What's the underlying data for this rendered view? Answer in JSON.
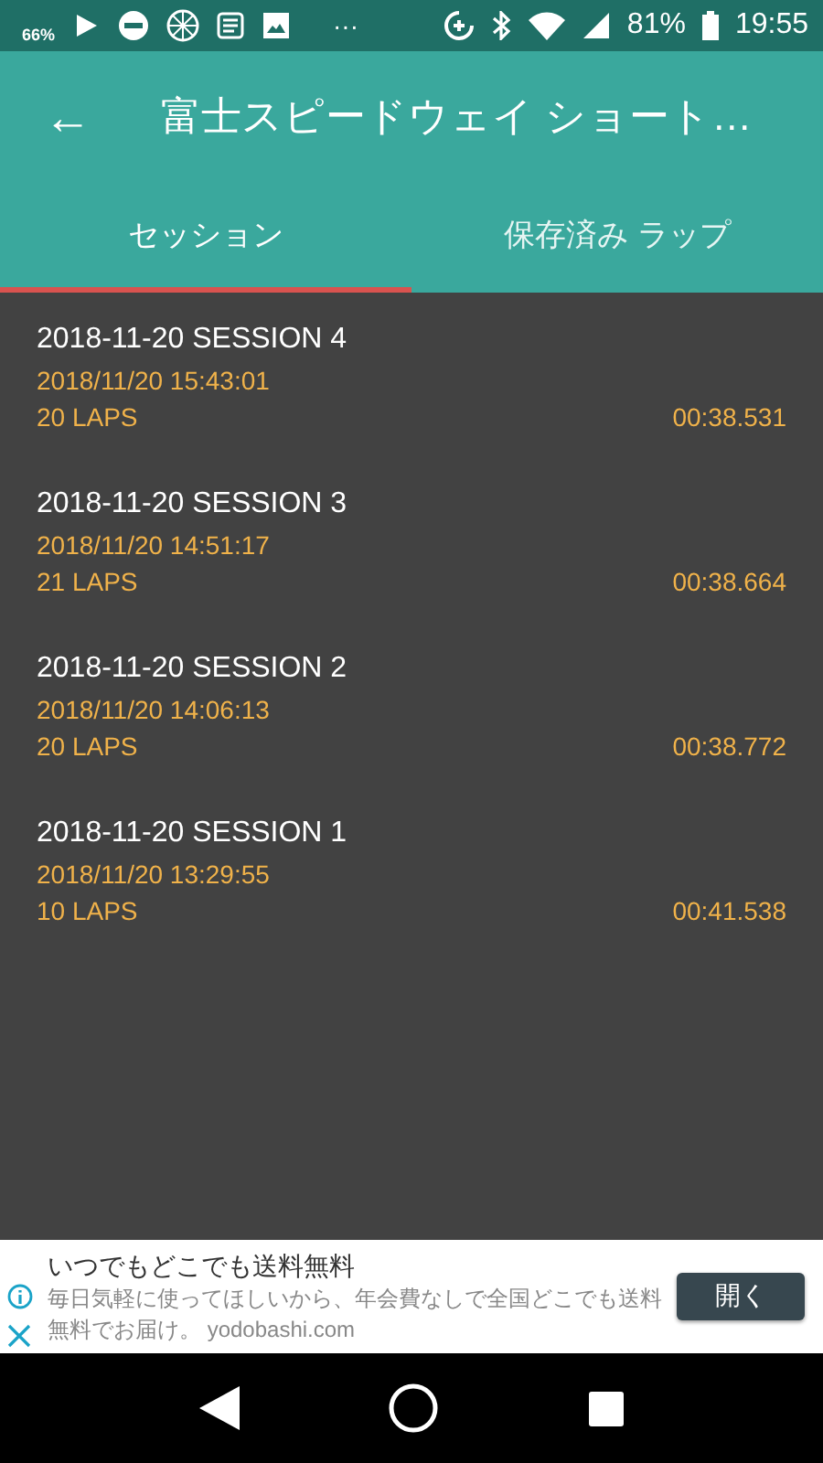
{
  "status_bar": {
    "fire_percent": "66%",
    "overflow": "···",
    "battery": "81%",
    "time": "19:55"
  },
  "app_bar": {
    "back": "←",
    "title": "富士スピードウェイ ショート…"
  },
  "tabs": [
    {
      "label": "セッション",
      "selected": true
    },
    {
      "label": "保存済み ラップ",
      "selected": false
    }
  ],
  "sessions": [
    {
      "name": "2018-11-20 SESSION 4",
      "datetime": "2018/11/20 15:43:01",
      "laps": "20 LAPS",
      "best": "00:38.531"
    },
    {
      "name": "2018-11-20 SESSION 3",
      "datetime": "2018/11/20 14:51:17",
      "laps": "21 LAPS",
      "best": "00:38.664"
    },
    {
      "name": "2018-11-20 SESSION 2",
      "datetime": "2018/11/20 14:06:13",
      "laps": "20 LAPS",
      "best": "00:38.772"
    },
    {
      "name": "2018-11-20 SESSION 1",
      "datetime": "2018/11/20 13:29:55",
      "laps": "10 LAPS",
      "best": "00:41.538"
    }
  ],
  "ad": {
    "headline": "いつでもどこでも送料無料",
    "body": "毎日気軽に使ってほしいから、年会費なしで全国どこでも送料無料でお届け。 yodobashi.com",
    "button": "開く"
  }
}
